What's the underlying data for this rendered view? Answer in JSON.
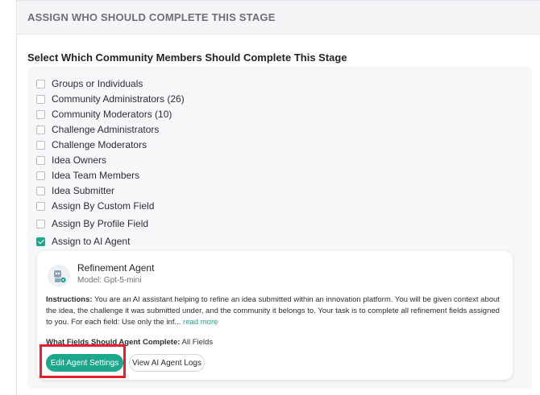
{
  "panel": {
    "header": "ASSIGN WHO SHOULD COMPLETE THIS STAGE",
    "section_title": "Select Which Community Members Should Complete This Stage"
  },
  "options": [
    {
      "label": "Groups or Individuals",
      "checked": false
    },
    {
      "label": "Community Administrators (26)",
      "checked": false
    },
    {
      "label": "Community Moderators (10)",
      "checked": false
    },
    {
      "label": "Challenge Administrators",
      "checked": false
    },
    {
      "label": "Challenge Moderators",
      "checked": false
    },
    {
      "label": "Idea Owners",
      "checked": false
    },
    {
      "label": "Idea Team Members",
      "checked": false
    },
    {
      "label": "Idea Submitter",
      "checked": false
    },
    {
      "label": "Assign By Custom Field",
      "checked": false
    },
    {
      "label": "Assign By Profile Field",
      "checked": false
    },
    {
      "label": "Assign to AI Agent",
      "checked": true
    }
  ],
  "agent": {
    "name": "Refinement Agent",
    "model": "Model: Gpt-5-mini",
    "instructions_label": "Instructions:",
    "instructions_text": " You are an AI assistant helping to refine an idea submitted within an innovation platform. You will be given context about the idea, the challenge it was submitted under, and the community it belongs to. Your task is to complete all refinement fields assigned to you. For each field: Use only the inf...",
    "read_more": "read more",
    "fields_label": "What Fields Should Agent Complete:",
    "fields_value": " All Fields",
    "edit_button": "Edit Agent Settings",
    "logs_button": "View AI Agent Logs"
  },
  "colors": {
    "accent": "#1ea88b",
    "highlight": "#ea1d2c",
    "header_bg": "#f4f5f6",
    "list_bg": "#f6f7f8"
  },
  "icons": {
    "agent_avatar": "ai-agent-icon",
    "checkbox": "checkbox-icon"
  }
}
